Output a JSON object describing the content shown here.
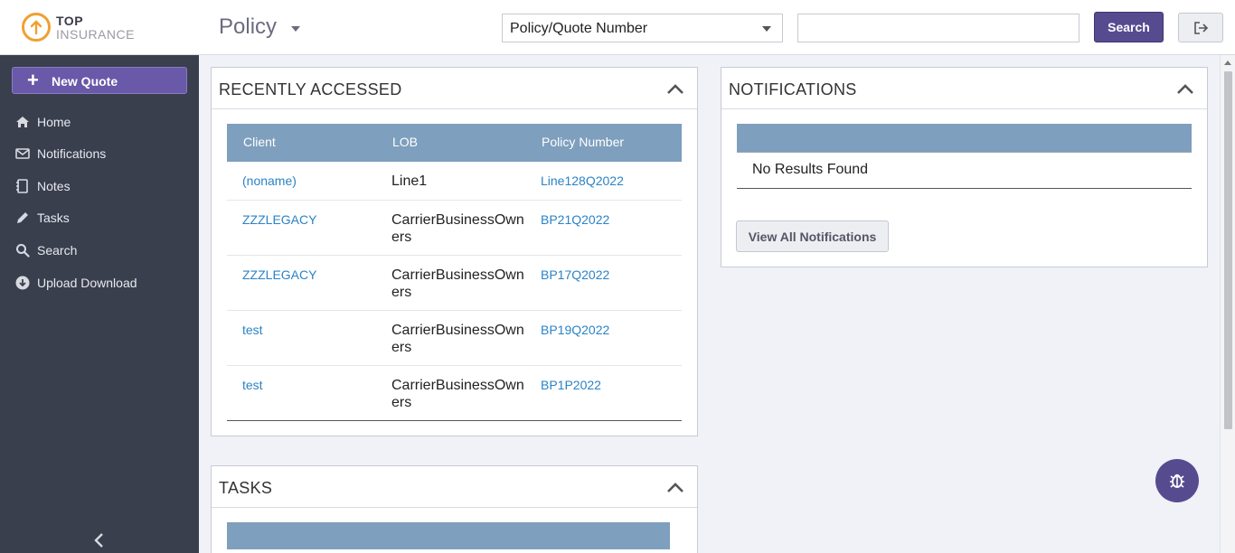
{
  "brand": {
    "line1": "TOP",
    "line2": "INSURANCE"
  },
  "header": {
    "module": "Policy",
    "search_type": "Policy/Quote Number",
    "search_value": "",
    "search_button": "Search"
  },
  "sidebar": {
    "new_quote": "New Quote",
    "items": [
      {
        "label": "Home",
        "icon": "home-icon"
      },
      {
        "label": "Notifications",
        "icon": "envelope-icon"
      },
      {
        "label": "Notes",
        "icon": "notebook-icon"
      },
      {
        "label": "Tasks",
        "icon": "pencil-icon"
      },
      {
        "label": "Search",
        "icon": "search-icon"
      },
      {
        "label": "Upload Download",
        "icon": "download-icon"
      }
    ]
  },
  "recent": {
    "title": "RECENTLY ACCESSED",
    "columns": [
      "Client",
      "LOB",
      "Policy Number"
    ],
    "rows": [
      {
        "client": "(noname)",
        "lob": "Line1",
        "policy": "Line128Q2022"
      },
      {
        "client": "ZZZLEGACY",
        "lob": "CarrierBusinessOwners",
        "policy": "BP21Q2022"
      },
      {
        "client": "ZZZLEGACY",
        "lob": "CarrierBusinessOwners",
        "policy": "BP17Q2022"
      },
      {
        "client": "test",
        "lob": "CarrierBusinessOwners",
        "policy": "BP19Q2022"
      },
      {
        "client": "test",
        "lob": "CarrierBusinessOwners",
        "policy": "BP1P2022"
      }
    ]
  },
  "notifications": {
    "title": "NOTIFICATIONS",
    "empty": "No Results Found",
    "view_all": "View All Notifications"
  },
  "tasks": {
    "title": "TASKS"
  },
  "colors": {
    "accent": "#574b90",
    "table_header": "#7e9fbd",
    "link": "#2b83c6",
    "sidebar": "#3a3f4e"
  }
}
